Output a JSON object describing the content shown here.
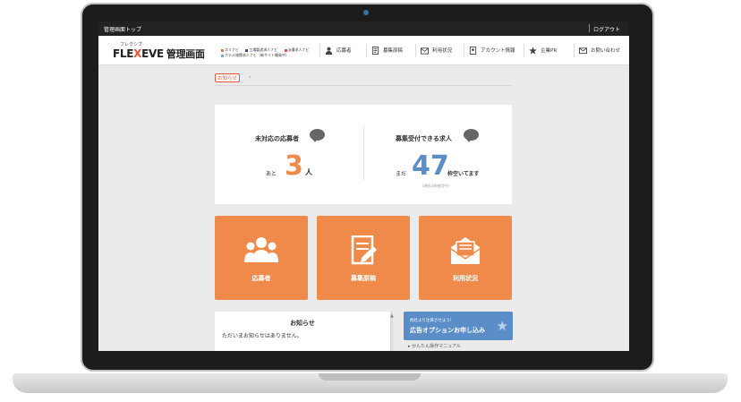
{
  "topbar": {
    "left": "管理画面トップ",
    "right": "ログアウト"
  },
  "logo": {
    "kana": "フレクシブ",
    "prefix": "FLE",
    "x": "X",
    "suffix": "EVE",
    "sub": "管理画面"
  },
  "sites": [
    {
      "label": "スミナビ",
      "color": "#f07a3c"
    },
    {
      "label": "工場製造求人ナビ",
      "color": "#3a4a8a"
    },
    {
      "label": "派遣求人ナビ",
      "color": "#e8543a"
    },
    {
      "label": "ホテル旅館求人ナビ（新サイト開発中）",
      "color": "#6fa9d9"
    }
  ],
  "nav": [
    {
      "label": "応募者",
      "icon": "person-icon"
    },
    {
      "label": "募集原稿",
      "icon": "document-icon"
    },
    {
      "label": "利用状況",
      "icon": "mail-icon"
    },
    {
      "label": "アカウント情報",
      "icon": "account-icon"
    },
    {
      "label": "企業PR",
      "icon": "star-icon"
    },
    {
      "label": "お問い合わせ",
      "icon": "envelope-icon"
    }
  ],
  "breadcrumb": {
    "current": "お知らせ",
    "arrow": "›"
  },
  "stats": {
    "applicants": {
      "title": "未対応の応募者",
      "prefix": "あと",
      "value": "3",
      "unit": "人"
    },
    "jobs": {
      "title": "募集受付できる求人",
      "prefix": "まだ",
      "value": "47",
      "unit": "枠空いてます",
      "note": "(現在3枠使用中)"
    }
  },
  "tiles": [
    {
      "label": "応募者",
      "icon": "people-icon"
    },
    {
      "label": "募集原稿",
      "icon": "edit-document-icon"
    },
    {
      "label": "利用状況",
      "icon": "mail-open-icon"
    }
  ],
  "news": {
    "title": "お知らせ",
    "body": "ただいまお知らせはありません。",
    "scroll": "▲"
  },
  "ad": {
    "sub": "他社より注目させよう!",
    "main": "広告オプションお申し込み",
    "star": "★"
  },
  "manual": {
    "label": "▸ かんたん操作マニュアル"
  },
  "colors": {
    "accent": "#f08a4b",
    "blue_number": "#5b8ec9",
    "orange_number": "#f08a4b"
  }
}
